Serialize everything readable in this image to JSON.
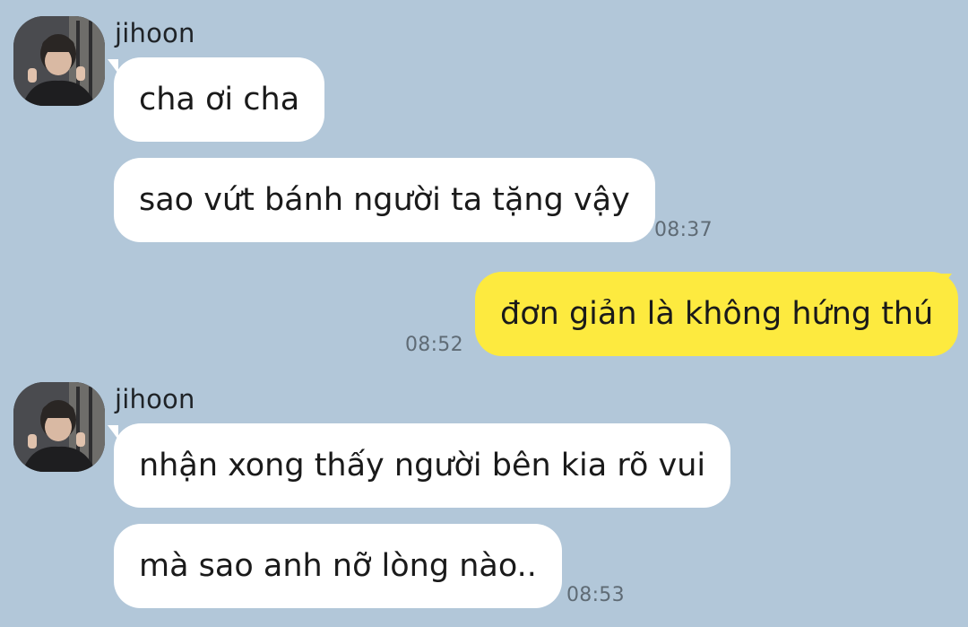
{
  "colors": {
    "background": "#b2c7d9",
    "incoming_bubble": "#ffffff",
    "outgoing_bubble": "#fdea3f",
    "timestamp": "#5f6b75"
  },
  "groups": [
    {
      "sender": "jihoon",
      "avatar_icon": "profile-photo",
      "messages": [
        "cha ơi cha",
        "sao vứt bánh người ta tặng vậy"
      ],
      "time": "08:37"
    },
    {
      "sender": "me",
      "messages": [
        "đơn giản là không hứng thú"
      ],
      "time": "08:52"
    },
    {
      "sender": "jihoon",
      "avatar_icon": "profile-photo",
      "messages": [
        "nhận xong thấy người bên kia rõ vui",
        "mà sao anh nỡ lòng nào.."
      ],
      "time": "08:53"
    }
  ]
}
